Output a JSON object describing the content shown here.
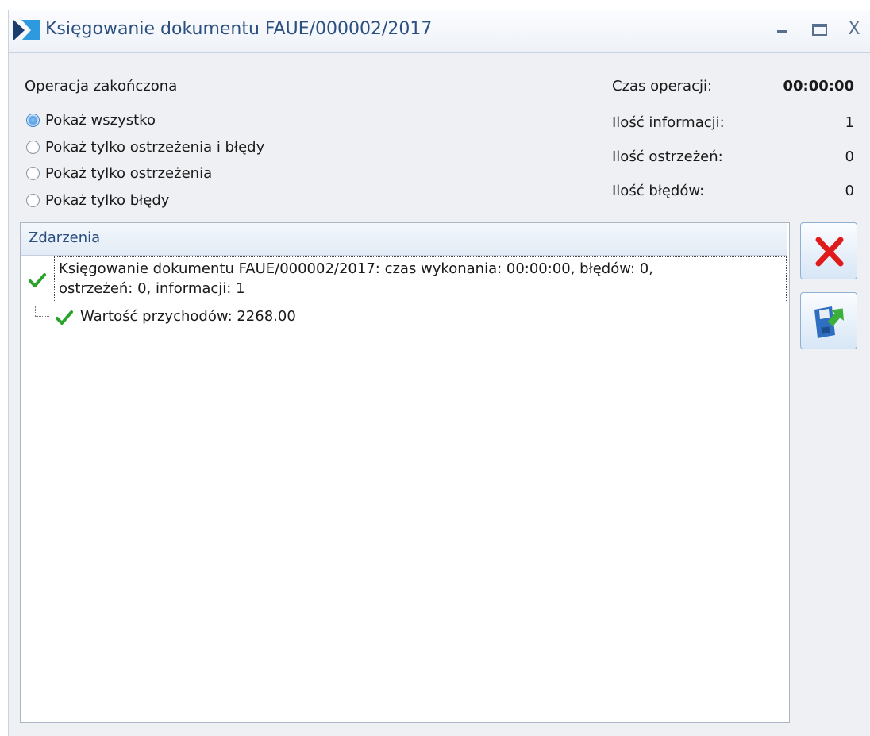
{
  "window": {
    "title": "Księgowanie dokumentu FAUE/000002/2017",
    "close_glyph": "X"
  },
  "status": {
    "title": "Operacja zakończona"
  },
  "filters": [
    {
      "label": "Pokaż wszystko",
      "checked": true
    },
    {
      "label": "Pokaż tylko ostrzeżenia i błędy",
      "checked": false
    },
    {
      "label": "Pokaż tylko ostrzeżenia",
      "checked": false
    },
    {
      "label": "Pokaż tylko błędy",
      "checked": false
    }
  ],
  "stats": {
    "time_label": "Czas operacji:",
    "time_value": "00:00:00",
    "info_label": "Ilość informacji:",
    "info_value": "1",
    "warnings_label": "Ilość ostrzeżeń:",
    "warnings_value": "0",
    "errors_label": "Ilość błędów:",
    "errors_value": "0"
  },
  "events": {
    "header": "Zdarzenia",
    "root": {
      "line1": "Księgowanie dokumentu FAUE/000002/2017: czas wykonania: 00:00:00, błędów: 0,",
      "line2": "ostrzeżeń: 0, informacji: 1"
    },
    "child": "Wartość przychodów: 2268.00"
  },
  "icons": {
    "app": "app-logo-icon",
    "success": "checkmark-icon",
    "close_action": "red-x-icon",
    "save_action": "save-disk-icon"
  },
  "colors": {
    "title_text": "#2b4f80",
    "checkmark": "#2aa32a",
    "close_x": "#e01b1b",
    "radio_selected": "#5aa0e4"
  }
}
